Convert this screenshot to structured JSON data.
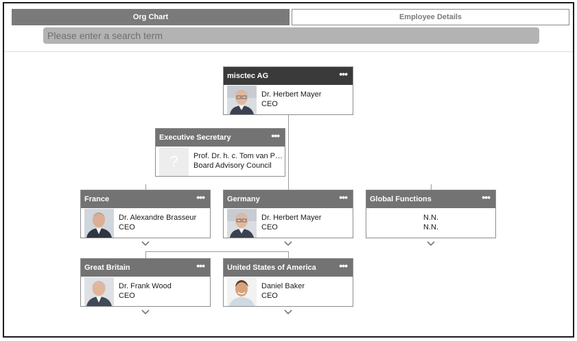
{
  "tabs": [
    {
      "label": "Org Chart"
    },
    {
      "label": "Employee Details"
    }
  ],
  "search": {
    "placeholder": "Please enter a search term"
  },
  "nodes": {
    "root": {
      "title": "misctec AG",
      "name": "Dr. Herbert Mayer",
      "role": "CEO"
    },
    "secretary": {
      "title": "Executive Secretary",
      "name": "Prof. Dr. h. c. Tom van P…",
      "role": "Board Advisory Council"
    },
    "france": {
      "title": "France",
      "name": "Dr. Alexandre Brasseur",
      "role": "CEO"
    },
    "germany": {
      "title": "Germany",
      "name": "Dr. Herbert Mayer",
      "role": "CEO"
    },
    "global": {
      "title": "Global Functions",
      "name": "N.N.",
      "role": "N.N."
    },
    "gb": {
      "title": "Great Britain",
      "name": "Dr. Frank Wood",
      "role": "CEO"
    },
    "usa": {
      "title": "United States of America",
      "name": "Daniel Baker",
      "role": "CEO"
    }
  },
  "menu_glyph": "•••",
  "placeholder_glyph": "?",
  "colors": {
    "header": "#737373",
    "header_root": "#3a3a3a",
    "tab_active": "#7a7a7a",
    "search_bg": "#b3b3b3"
  }
}
